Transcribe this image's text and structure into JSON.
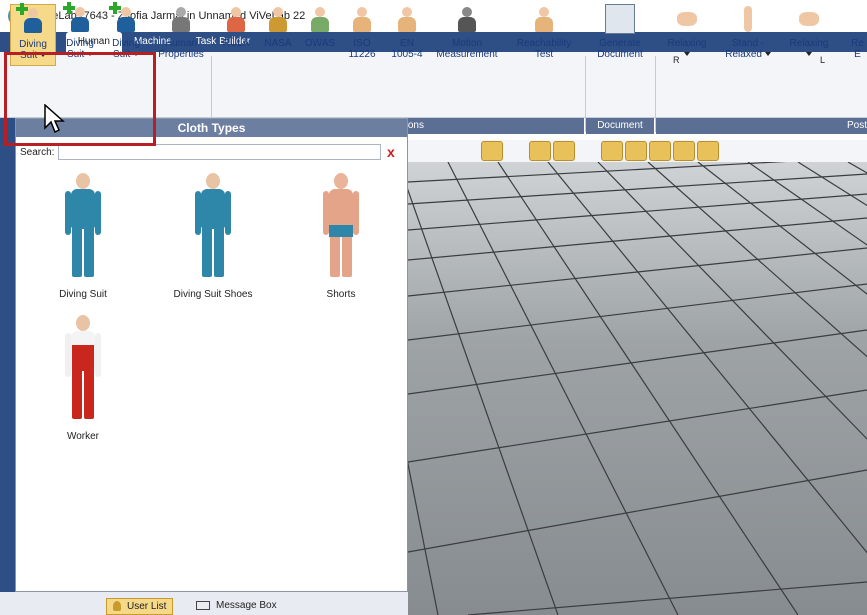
{
  "window": {
    "title": "ViVeLab r7643 - Zsofia Jarmai in Unnamed ViVeLab 22"
  },
  "tabs": [
    "Main",
    "Human",
    "Machine",
    "Task Builder"
  ],
  "ribbon": {
    "buttons": [
      {
        "label1": "Diving",
        "label2": "Suit"
      },
      {
        "label1": "Diving",
        "label2": "Suit"
      },
      {
        "label1": "Diving",
        "label2": "Suit"
      },
      {
        "label1": "Human",
        "label2": "Properties"
      },
      {
        "label1": "RULA",
        "label2": ""
      },
      {
        "label1": "NASA",
        "label2": ""
      },
      {
        "label1": "OWAS",
        "label2": ""
      },
      {
        "label1": "ISO",
        "label2": "11226"
      },
      {
        "label1": "EN",
        "label2": "1005-4"
      },
      {
        "label1": "Motion",
        "label2": "Measurement"
      },
      {
        "label1": "Reachability",
        "label2": "Test"
      },
      {
        "label1": "Generate",
        "label2": "Document"
      },
      {
        "label1": "Relaxing",
        "label2": ""
      },
      {
        "label1": "Stand -",
        "label2": "Relaxed"
      },
      {
        "label1": "Relaxing",
        "label2": ""
      },
      {
        "label1": "Re",
        "label2": "E"
      }
    ],
    "groups": [
      "ions",
      "Document",
      "Post"
    ],
    "hand_labels": {
      "right": "R",
      "left": "L"
    }
  },
  "cloth_panel": {
    "title": "Cloth Types",
    "search_label": "Search:",
    "search_value": "",
    "clear_icon": "x",
    "items": [
      {
        "label": "Diving Suit",
        "color": "#2e86a8"
      },
      {
        "label": "Diving Suit Shoes",
        "color": "#2e86a8"
      },
      {
        "label": "Shorts",
        "color": "#e3a489"
      },
      {
        "label": "Worker",
        "color": "#c9261e"
      }
    ]
  },
  "status": {
    "user_list": "User List",
    "message_box": "Message Box"
  },
  "colors": {
    "tabbar": "#2d4f86",
    "accent": "#b61f24"
  }
}
